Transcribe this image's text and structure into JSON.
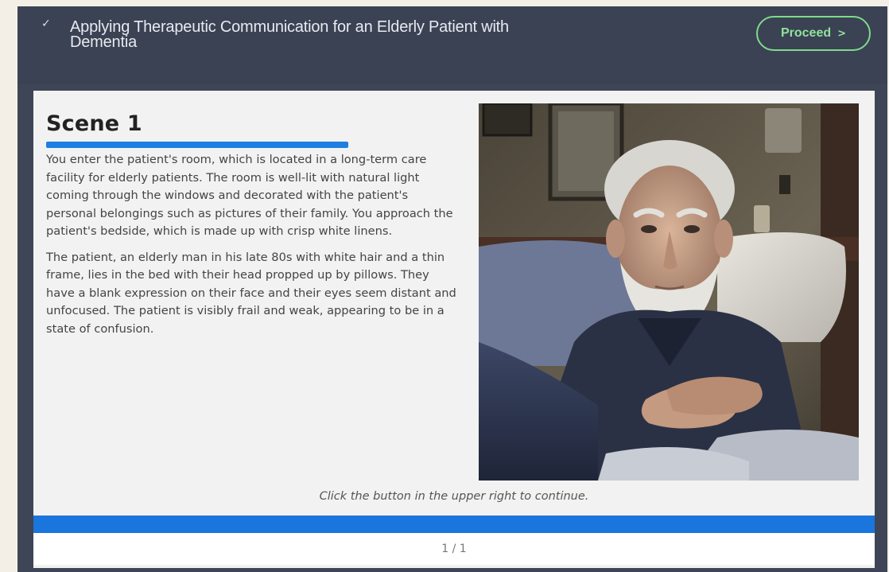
{
  "header": {
    "check_icon": "check-icon",
    "course_title": "Applying Therapeutic Communication for an Elderly Patient with Dementia",
    "proceed_label": "Proceed",
    "proceed_icon": "chevron-right-icon",
    "accent_color": "#7ddc8a"
  },
  "scene": {
    "title": "Scene 1",
    "paragraphs": [
      "You enter the patient's room, which is located in a long-term care facility for elderly patients. The room is well-lit with natural light coming through the windows and decorated with the patient's personal belongings such as pictures of their family. You approach the patient's bedside, which is made up with crisp white linens.",
      "The patient, an elderly man in his late 80s with white hair and a thin frame, lies in the bed with their head propped up by pillows. They have a blank expression on their face and their eyes seem distant and unfocused. The patient is visibly frail and weak, appearing to be in a state of confusion."
    ],
    "image_subject": "elderly-patient-in-bed-photo",
    "underline_color": "#1e7fe0"
  },
  "footer": {
    "instruction": "Click the button in the upper right to continue.",
    "progress_fraction": 1.0,
    "progress_color": "#1a76dc",
    "page_indicator": "1 / 1"
  }
}
